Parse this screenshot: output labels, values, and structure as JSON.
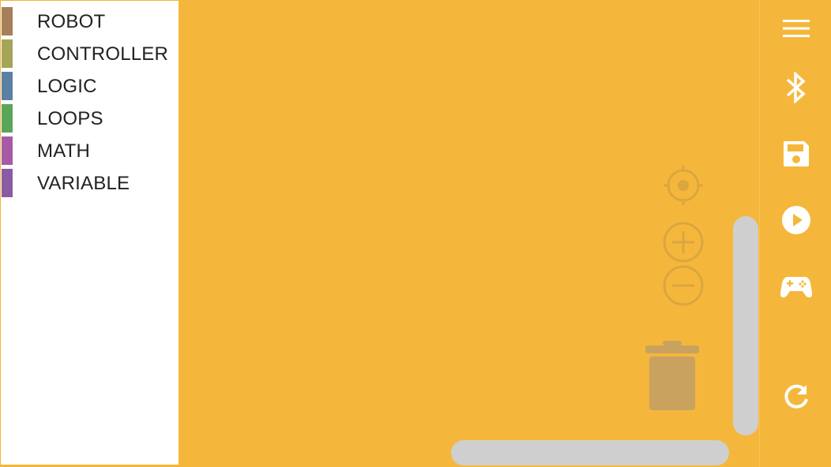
{
  "toolbox": {
    "categories": [
      {
        "label": "ROBOT",
        "color": "#A5805A"
      },
      {
        "label": "CONTROLLER",
        "color": "#A5A55A"
      },
      {
        "label": "LOGIC",
        "color": "#5B80A5"
      },
      {
        "label": "LOOPS",
        "color": "#5BA55B"
      },
      {
        "label": "MATH",
        "color": "#A55BA5"
      },
      {
        "label": "VARIABLE",
        "color": "#8A5BA5"
      }
    ]
  },
  "workspace": {
    "background": "#F5B73B",
    "controls": [
      "recenter-icon",
      "zoom-in-icon",
      "zoom-out-icon",
      "trash-icon"
    ]
  },
  "sidebar": {
    "buttons": [
      "menu-icon",
      "bluetooth-icon",
      "save-icon",
      "play-icon",
      "gamepad-icon",
      "refresh-icon"
    ]
  }
}
